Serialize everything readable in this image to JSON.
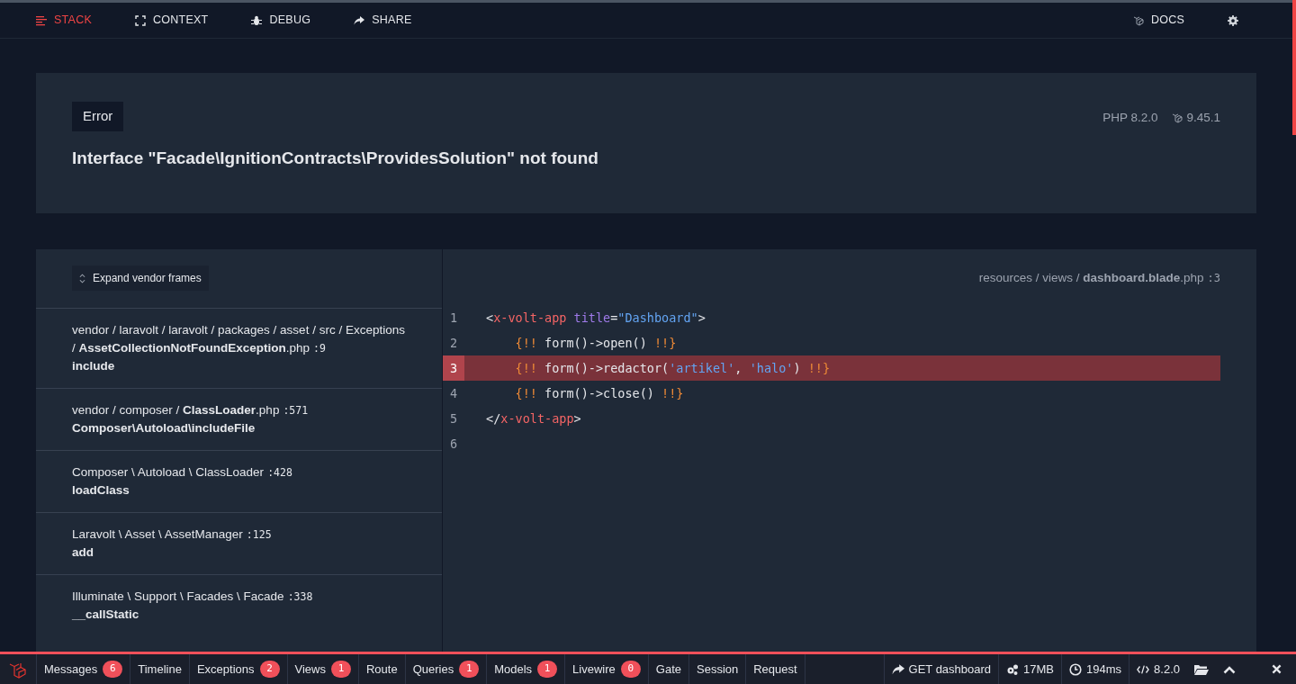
{
  "nav": {
    "tabs": [
      {
        "label": "STACK",
        "selected": true
      },
      {
        "label": "CONTEXT",
        "selected": false
      },
      {
        "label": "DEBUG",
        "selected": false
      },
      {
        "label": "SHARE",
        "selected": false
      }
    ],
    "docs": "DOCS"
  },
  "error": {
    "type": "Error",
    "message": "Interface \"Facade\\IgnitionContracts\\ProvidesSolution\" not found",
    "php_version": "PHP 8.2.0",
    "laravel_version": "9.45.1"
  },
  "stack": {
    "expand_button": "Expand vendor frames",
    "frames": [
      {
        "path": "vendor / laravolt / laravolt / packages / asset / src / Exceptions / **AssetCollectionNotFoundException**.php",
        "line": ":9",
        "method": "include"
      },
      {
        "path": "vendor / composer / **ClassLoader**.php",
        "line": ":571",
        "method": "Composer\\Autoload\\includeFile"
      },
      {
        "path": "Composer \\ Autoload \\ ClassLoader",
        "line": ":428",
        "method": "loadClass"
      },
      {
        "path": "Laravolt \\ Asset \\ AssetManager",
        "line": ":125",
        "method": "add"
      },
      {
        "path": "Illuminate \\ Support \\ Facades \\ Facade",
        "line": ":338",
        "method": "__callStatic"
      }
    ]
  },
  "code": {
    "file": "resources / views / **dashboard.blade**.php",
    "line": ":3",
    "lines": [
      {
        "number": "1",
        "selected": false,
        "indented": false,
        "tokens": [
          {
            "kind": "plain",
            "text": "<"
          },
          {
            "kind": "tag",
            "text": "x-volt-app"
          },
          {
            "kind": "attr",
            "text": "title"
          },
          {
            "kind": "plain",
            "text": "="
          },
          {
            "kind": "string",
            "text": "\"Dashboard\""
          },
          {
            "kind": "plain",
            "text": ">"
          }
        ]
      },
      {
        "number": "2",
        "selected": false,
        "indented": true,
        "tokens": [
          {
            "kind": "blade",
            "text": "{!!"
          },
          {
            "kind": "plain",
            "text": " form()->open() "
          },
          {
            "kind": "blade",
            "text": "!!}"
          }
        ]
      },
      {
        "number": "3",
        "selected": true,
        "indented": true,
        "tokens": [
          {
            "kind": "blade",
            "text": "{!!"
          },
          {
            "kind": "plain",
            "text": " form()->redactor("
          },
          {
            "kind": "string",
            "text": "'artikel'"
          },
          {
            "kind": "plain",
            "text": ", "
          },
          {
            "kind": "string",
            "text": "'halo'"
          },
          {
            "kind": "plain",
            "text": ") "
          },
          {
            "kind": "blade",
            "text": "!!}"
          }
        ]
      },
      {
        "number": "4",
        "selected": false,
        "indented": true,
        "tokens": [
          {
            "kind": "blade",
            "text": "{!!"
          },
          {
            "kind": "plain",
            "text": " form()->close() "
          },
          {
            "kind": "blade",
            "text": "!!}"
          }
        ]
      },
      {
        "number": "5",
        "selected": false,
        "indented": false,
        "tokens": [
          {
            "kind": "plain",
            "text": "</"
          },
          {
            "kind": "tag",
            "text": "x-volt-app"
          },
          {
            "kind": "plain",
            "text": ">"
          }
        ]
      },
      {
        "number": "6",
        "selected": false
      }
    ]
  },
  "debugbar": {
    "tabs": [
      {
        "label": "Messages",
        "badge": "6"
      },
      {
        "label": "Timeline"
      },
      {
        "label": "Exceptions",
        "badge": "2"
      },
      {
        "label": "Views",
        "badge": "1"
      },
      {
        "label": "Route"
      },
      {
        "label": "Queries",
        "badge": "1"
      },
      {
        "label": "Models",
        "badge": "1"
      },
      {
        "label": "Livewire",
        "badge": "0"
      },
      {
        "label": "Gate"
      },
      {
        "label": "Session"
      },
      {
        "label": "Request"
      }
    ],
    "indicators": [
      {
        "text": "GET dashboard"
      },
      {
        "text": "17MB"
      },
      {
        "text": "194ms"
      },
      {
        "text": "8.2.0"
      }
    ]
  }
}
